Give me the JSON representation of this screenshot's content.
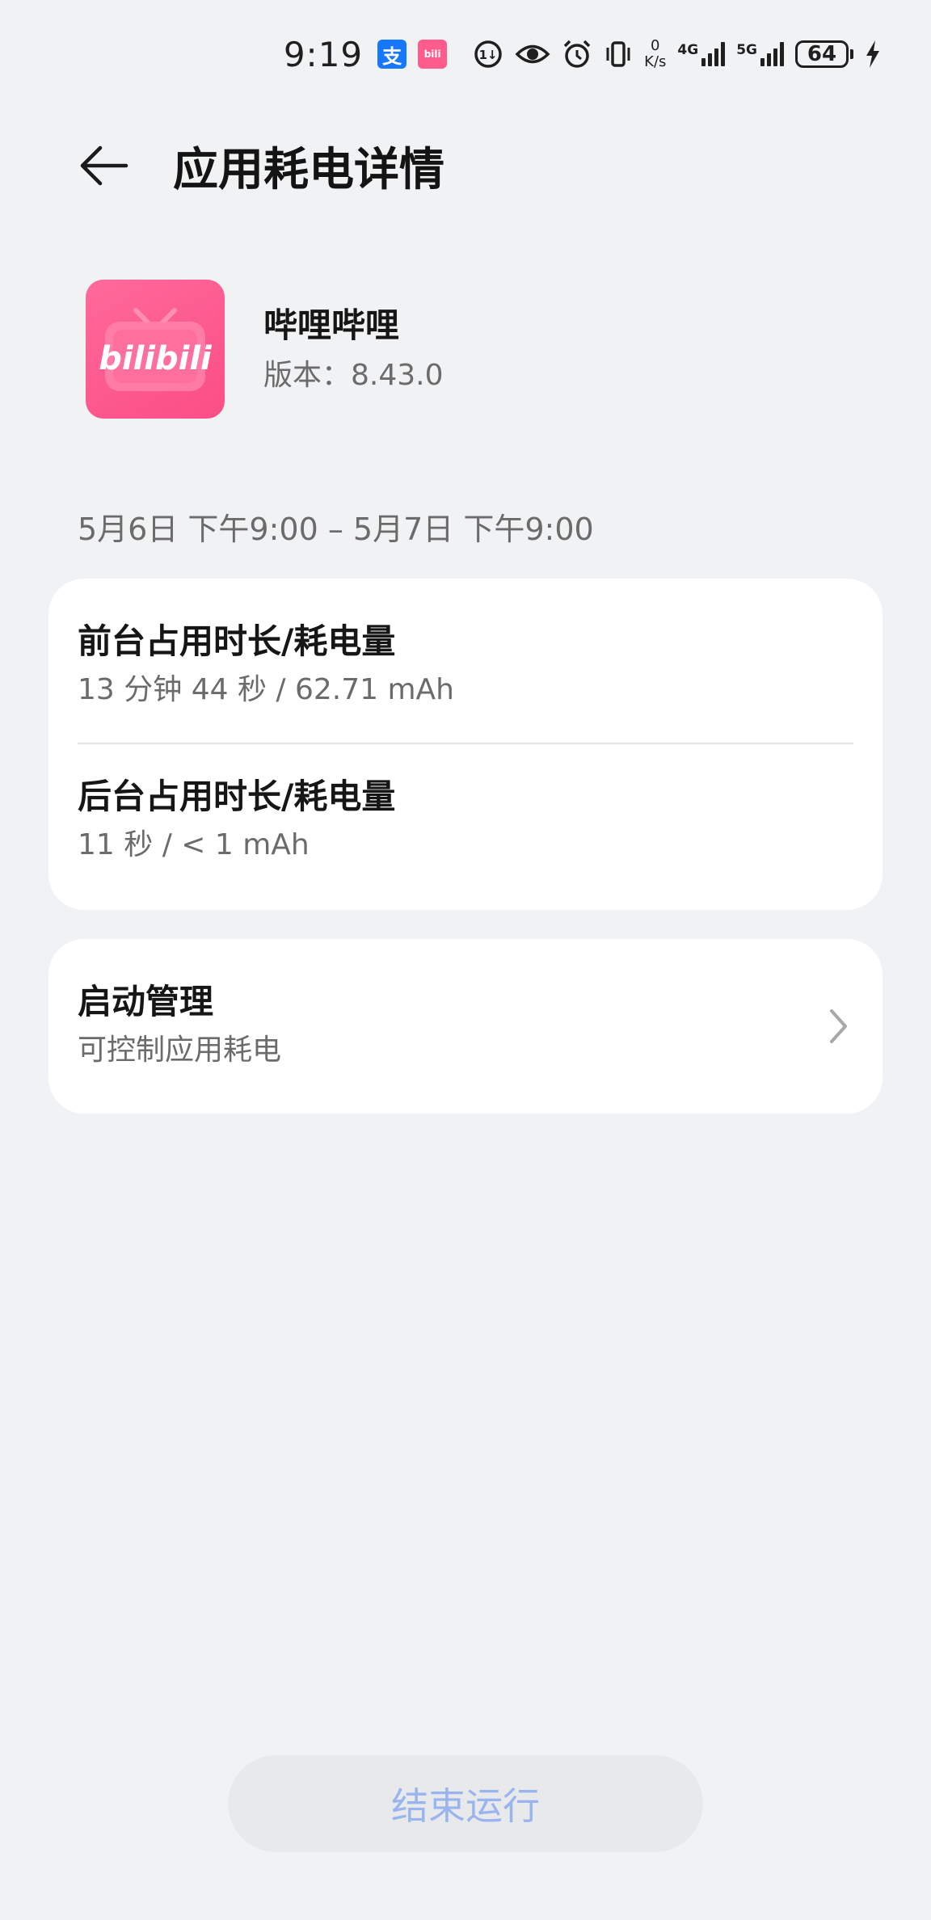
{
  "status_bar": {
    "time": "9:19",
    "notification_icons": [
      "alipay-icon",
      "bilibili-icon"
    ],
    "alipay_glyph": "支",
    "bilibili_glyph": "bili",
    "net_speed_value": "0",
    "net_speed_unit": "K/s",
    "sim1_label": "4G",
    "sim2_label": "5G",
    "battery_level": "64",
    "charging": true
  },
  "header": {
    "title": "应用耗电详情"
  },
  "app": {
    "name": "哔哩哔哩",
    "version_label": "版本：8.43.0",
    "icon_text": "bilibili",
    "icon_color": "#fb5a8f"
  },
  "date_range": "5月6日 下午9:00 – 5月7日 下午9:00",
  "usage": {
    "foreground": {
      "label": "前台占用时长/耗电量",
      "value": "13 分钟 44 秒 / 62.71 mAh"
    },
    "background": {
      "label": "后台占用时长/耗电量",
      "value": "11 秒 / < 1 mAh"
    }
  },
  "startup": {
    "label": "启动管理",
    "sublabel": "可控制应用耗电"
  },
  "end_button": {
    "label": "结束运行",
    "color": "#99b4ee"
  }
}
